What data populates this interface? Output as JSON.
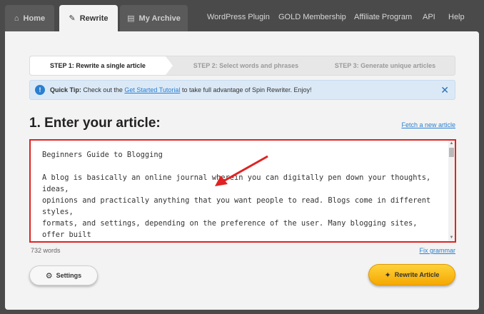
{
  "nav": {
    "tabs": [
      {
        "label": "Home",
        "icon": "home-icon"
      },
      {
        "label": "Rewrite",
        "icon": "pencil-icon"
      },
      {
        "label": "My Archive",
        "icon": "archive-icon"
      }
    ],
    "links": [
      "WordPress Plugin",
      "GOLD Membership",
      "Affiliate Program",
      "API",
      "Help"
    ]
  },
  "steps": [
    "STEP 1: Rewrite a single article",
    "STEP 2: Select words and phrases",
    "STEP 3: Generate unique articles"
  ],
  "tip": {
    "label": "Quick Tip:",
    "text_before": " Check out the ",
    "link": "Get Started Tutorial",
    "text_after": " to take full advantage of Spin Rewriter. Enjoy!"
  },
  "article": {
    "heading": "1. Enter your article:",
    "fetch_link": "Fetch a new article",
    "content": "Beginners Guide to Blogging\n\nA blog is basically an online journal wherein you can digitally pen down your thoughts, ideas,\nopinions and practically anything that you want people to read. Blogs come in different styles,\nformats, and settings, depending on the preference of the user. Many blogging sites, offer built\nin features such as hyperlink, straight texts, pictures etc. Some blogging sites, even allow you\nto put video and mp3's on your blogs.\n\nInstead of writing texts, some bloggers choose to make their blogs more audio friendly, by using",
    "word_count": "732 words",
    "fix_grammar": "Fix grammar"
  },
  "buttons": {
    "settings": "Settings",
    "rewrite": "Rewrite Article"
  },
  "colors": {
    "accent": "#2a7fd0",
    "highlight_border": "#e02222",
    "rewrite_button": "#f5a800"
  }
}
